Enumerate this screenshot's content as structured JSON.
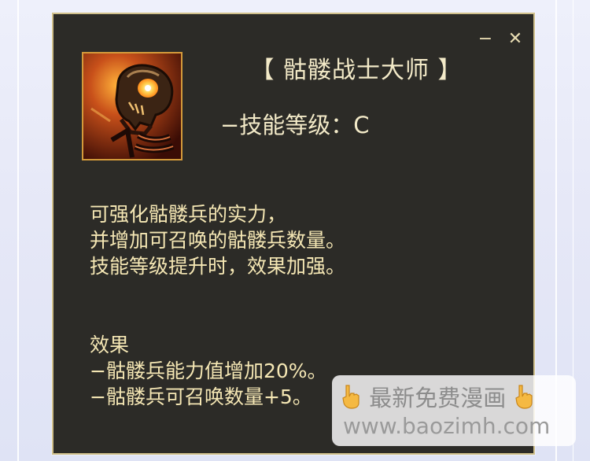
{
  "window": {
    "minimize_label": "−",
    "close_label": "✕",
    "icon": "skeleton-warrior-skill-icon"
  },
  "skill": {
    "title": "【 骷髅战士大师 】",
    "level_line": "−技能等级：C",
    "description": [
      "可强化骷髅兵的实力，",
      "并增加可召唤的骷髅兵数量。",
      "技能等级提升时，效果加强。"
    ],
    "effects_heading": "效果",
    "effects": [
      "−骷髅兵能力值增加20%。",
      "−骷髅兵可召唤数量+5。"
    ]
  },
  "watermark": {
    "line1": "最新免费漫画",
    "line2": "www.baozimh.com",
    "icon": "pointing-hand-icon"
  },
  "colors": {
    "panel_bg": "#2c2b27",
    "panel_border": "#cfbf8a",
    "title_text": "#f3eac8",
    "body_text": "#f5e7b4"
  }
}
